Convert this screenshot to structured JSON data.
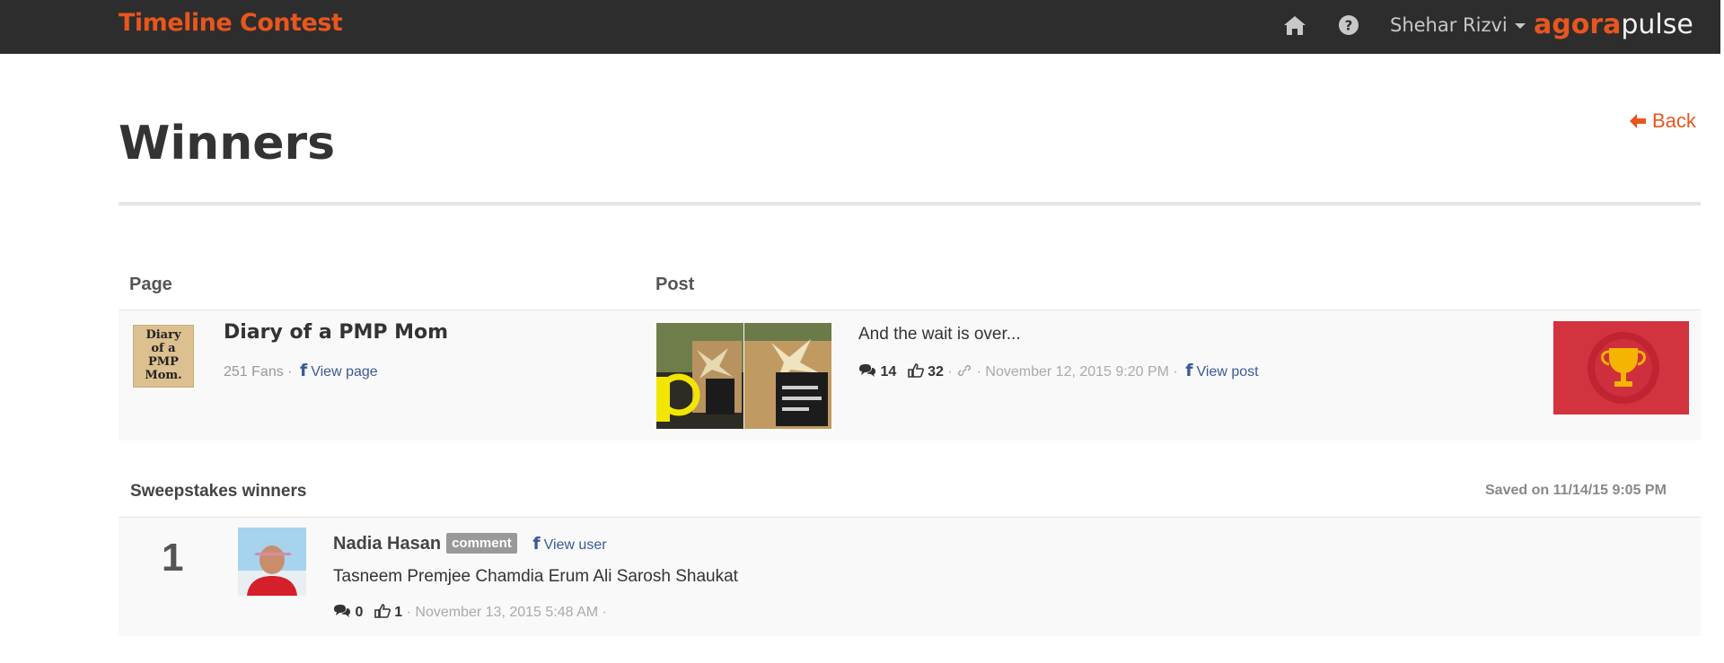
{
  "app": {
    "title": "Timeline Contest",
    "user_name": "Shehar Rizvi",
    "logo_part1": "agora",
    "logo_part2": "pulse",
    "nav_icons": [
      "home-icon",
      "help-icon"
    ]
  },
  "colors": {
    "brand": "#e8561e",
    "topbar": "#2d2d2d",
    "facebook": "#3b5998",
    "trophy_bg": "#d3323f"
  },
  "page_header": {
    "title": "Winners",
    "back_label": "Back"
  },
  "columns": {
    "page": "Page",
    "post": "Post"
  },
  "page_info": {
    "thumb_text": [
      "Diary",
      "of a",
      "PMP",
      "Mom."
    ],
    "name": "Diary of a PMP Mom",
    "fans": "251 Fans",
    "separator": "·",
    "fb_letter": "f",
    "view_label": "View page"
  },
  "post": {
    "text": "And the wait is over...",
    "comments": "14",
    "likes": "32",
    "date": "November 12, 2015 9:20 PM",
    "view_label": "View post"
  },
  "winners": {
    "heading": "Sweepstakes winners",
    "saved_prefix": "Saved on",
    "saved_date": "11/14/15 9:05 PM",
    "items": [
      {
        "rank": "1",
        "name": "Nadia Hasan",
        "badge": "comment",
        "view_label": "View user",
        "text": "Tasneem Premjee Chamdia Erum Ali Sarosh Shaukat",
        "comments": "0",
        "likes": "1",
        "date": "November 13, 2015 5:48 AM"
      }
    ]
  }
}
